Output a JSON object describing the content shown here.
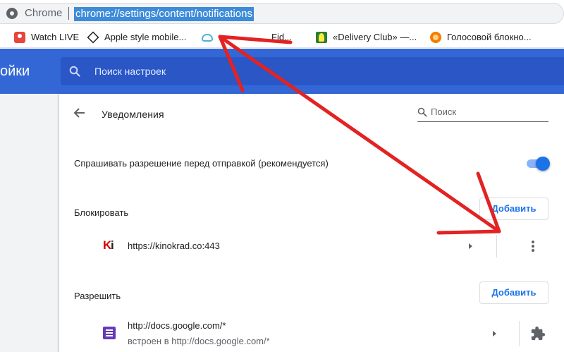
{
  "omnibox": {
    "site_label": "Chrome",
    "url": "chrome://settings/content/notifications"
  },
  "bookmarks": [
    {
      "label": "Watch LIVE",
      "icon": "video-icon"
    },
    {
      "label": "Apple style mobile...",
      "icon": "codepen-icon"
    },
    {
      "label": "…Fid...",
      "icon": "cloud-icon"
    },
    {
      "label": "«Delivery Club» —...",
      "icon": "ostrich-icon"
    },
    {
      "label": "Голосовой блокно...",
      "icon": "notepad-icon"
    }
  ],
  "header": {
    "title_partial": "ойки",
    "search_placeholder": "Поиск настроек"
  },
  "page": {
    "title": "Уведомления",
    "search_placeholder": "Поиск",
    "ask_before_sending_label": "Спрашивать разрешение перед отправкой (рекомендуется)",
    "ask_before_sending_enabled": true,
    "block": {
      "heading": "Блокировать",
      "add_label": "Добавить",
      "sites": [
        {
          "url": "https://kinokrad.co:443",
          "favicon": "ki-icon"
        }
      ]
    },
    "allow": {
      "heading": "Разрешить",
      "add_label": "Добавить",
      "sites": [
        {
          "url": "http://docs.google.com/*",
          "embedded": "встроен в http://docs.google.com/*",
          "favicon": "google-forms-icon",
          "controlled_by": "extension-icon"
        }
      ]
    }
  },
  "colors": {
    "header_blue": "#3367d6",
    "search_blue": "#2a56c6",
    "accent": "#1a73e8",
    "annotation_red": "#e32222"
  }
}
